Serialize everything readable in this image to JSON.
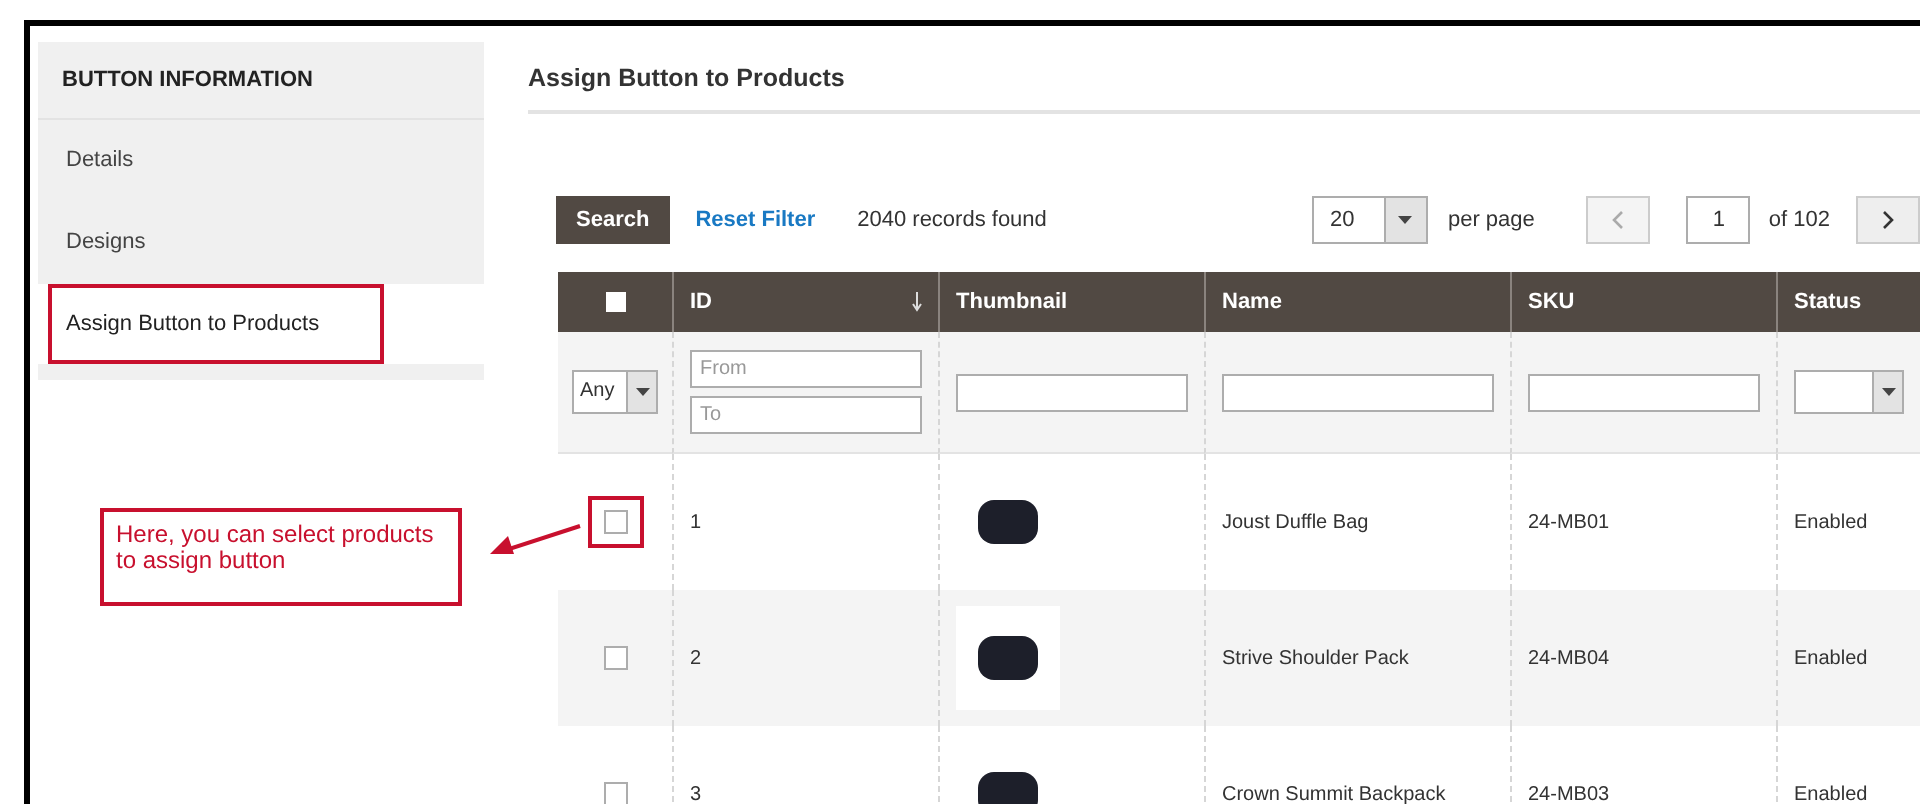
{
  "sidebar": {
    "title": "BUTTON INFORMATION",
    "items": [
      {
        "label": "Details",
        "selected": false
      },
      {
        "label": "Designs",
        "selected": false
      },
      {
        "label": "Assign Button to Products",
        "selected": true
      }
    ]
  },
  "section_title": "Assign Button to Products",
  "toolbar": {
    "search": "Search",
    "reset": "Reset Filter",
    "records": "2040 records found",
    "per_page_value": "20",
    "per_page_label": "per page",
    "page": "1",
    "of_pages": "of 102",
    "prev_disabled": true,
    "next_disabled": false
  },
  "table": {
    "select_all_checked": false,
    "columns": [
      {
        "label": "ID",
        "sorted": true
      },
      {
        "label": "Thumbnail",
        "sorted": false
      },
      {
        "label": "Name",
        "sorted": false
      },
      {
        "label": "SKU",
        "sorted": false
      },
      {
        "label": "Status",
        "sorted": false
      }
    ],
    "filters": {
      "any": "Any",
      "from_placeholder": "From",
      "to_placeholder": "To"
    },
    "rows": [
      {
        "checked": false,
        "highlighted": true,
        "id": "1",
        "name": "Joust Duffle Bag",
        "sku": "24-MB01",
        "status": "Enabled"
      },
      {
        "checked": false,
        "highlighted": false,
        "id": "2",
        "name": "Strive Shoulder Pack",
        "sku": "24-MB04",
        "status": "Enabled"
      },
      {
        "checked": false,
        "highlighted": false,
        "id": "3",
        "name": "Crown Summit Backpack",
        "sku": "24-MB03",
        "status": "Enabled"
      }
    ]
  },
  "callout": {
    "text": "Here, you can select products to assign button"
  }
}
